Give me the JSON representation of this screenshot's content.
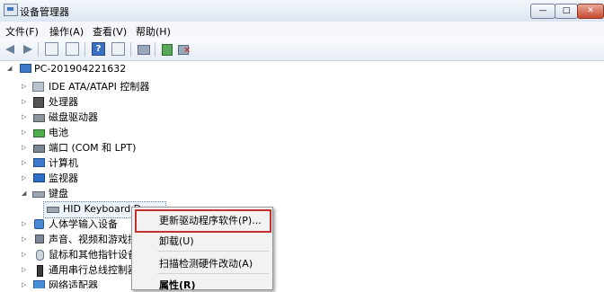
{
  "window": {
    "title": "设备管理器",
    "min_glyph": "—",
    "max_glyph": "□",
    "close_glyph": "✕"
  },
  "menu": [
    "文件(F)",
    "操作(A)",
    "查看(V)",
    "帮助(H)"
  ],
  "toolbar_help": "?",
  "tree": {
    "root": "PC-201904221632",
    "items": [
      "IDE ATA/ATAPI 控制器",
      "处理器",
      "磁盘驱动器",
      "电池",
      "端口 (COM 和 LPT)",
      "计算机",
      "监视器",
      "键盘",
      "HID Keyboard De",
      "人体学输入设备",
      "声音、视频和游戏控",
      "鼠标和其他指针设备",
      "通用串行总线控制器",
      "网络适配器"
    ]
  },
  "context_menu": {
    "items": [
      "更新驱动程序软件(P)...",
      "卸载(U)",
      "扫描检测硬件改动(A)",
      "属性(R)"
    ]
  },
  "colors": {
    "highlight_box": "#c62f2f"
  }
}
